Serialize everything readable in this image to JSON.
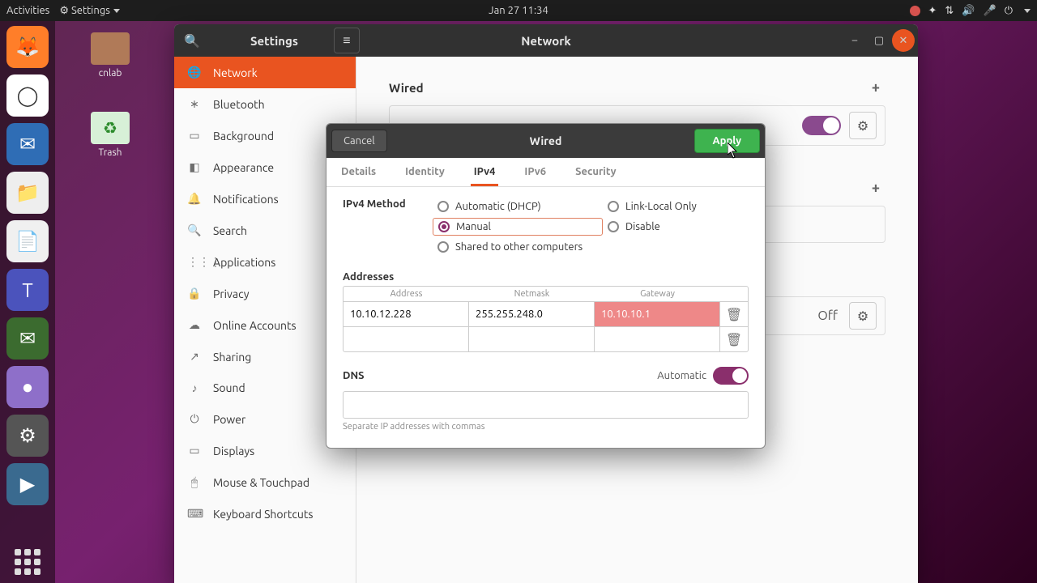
{
  "topbar": {
    "activities": "Activities",
    "app": "Settings",
    "datetime": "Jan 27  11:34"
  },
  "desktop": {
    "icons": [
      {
        "label": "cnlab",
        "color": "#a66b4a"
      },
      {
        "label": "Trash",
        "color": "#6fbf73"
      }
    ]
  },
  "window": {
    "title_left": "Settings",
    "title_center": "Network"
  },
  "sidebar": {
    "items": [
      {
        "icon": "🌐",
        "label": "Network",
        "active": true
      },
      {
        "icon": "∗",
        "label": "Bluetooth"
      },
      {
        "icon": "▭",
        "label": "Background"
      },
      {
        "icon": "◧",
        "label": "Appearance"
      },
      {
        "icon": "🔔",
        "label": "Notifications"
      },
      {
        "icon": "🔍",
        "label": "Search"
      },
      {
        "icon": "⋮⋮⋮",
        "label": "Applications"
      },
      {
        "icon": "🔒",
        "label": "Privacy"
      },
      {
        "icon": "☁",
        "label": "Online Accounts"
      },
      {
        "icon": "↗",
        "label": "Sharing"
      },
      {
        "icon": "♪",
        "label": "Sound"
      },
      {
        "icon": "⏻",
        "label": "Power"
      },
      {
        "icon": "▭",
        "label": "Displays"
      },
      {
        "icon": "🖱",
        "label": "Mouse & Touchpad"
      },
      {
        "icon": "⌨",
        "label": "Keyboard Shortcuts"
      }
    ]
  },
  "content": {
    "wired_label": "Wired",
    "off_label": "Off"
  },
  "dialog": {
    "cancel": "Cancel",
    "title": "Wired",
    "apply": "Apply",
    "tabs": [
      "Details",
      "Identity",
      "IPv4",
      "IPv6",
      "Security"
    ],
    "active_tab": "IPv4",
    "method_label": "IPv4 Method",
    "methods": {
      "auto": "Automatic (DHCP)",
      "linklocal": "Link-Local Only",
      "manual": "Manual",
      "disable": "Disable",
      "shared": "Shared to other computers"
    },
    "addresses_label": "Addresses",
    "addr_headers": [
      "Address",
      "Netmask",
      "Gateway"
    ],
    "addr_rows": [
      {
        "address": "10.10.12.228",
        "netmask": "255.255.248.0",
        "gateway": "10.10.10.1",
        "gateway_hl": true
      },
      {
        "address": "",
        "netmask": "",
        "gateway": ""
      }
    ],
    "dns_label": "DNS",
    "dns_auto": "Automatic",
    "dns_hint": "Separate IP addresses with commas"
  }
}
